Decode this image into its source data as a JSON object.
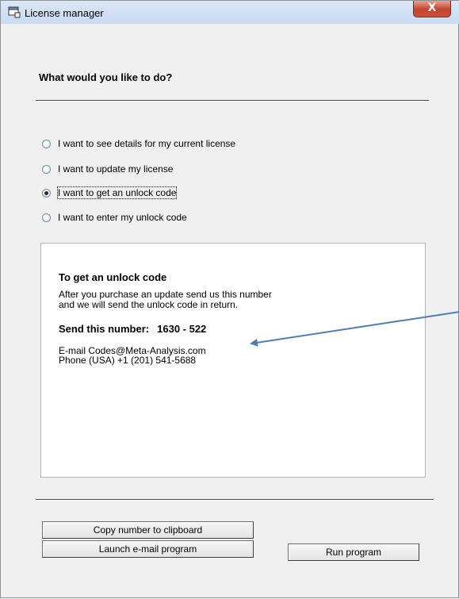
{
  "window": {
    "title": "License manager",
    "close_glyph": "X",
    "icon": "app-window-icon"
  },
  "prompt": "What would you like to do?",
  "options": [
    {
      "label": "I want to see details for my current license",
      "checked": false
    },
    {
      "label": "I want to update my license",
      "checked": false
    },
    {
      "label": "I want to get an unlock code",
      "checked": true
    },
    {
      "label": "I want to enter my unlock code",
      "checked": false
    }
  ],
  "info": {
    "heading": "To get an unlock code",
    "body_line1": "After you purchase an update send us this number",
    "body_line2": "and we will send the unlock code in return.",
    "send_label": "Send this number:",
    "send_number": "1630 - 522",
    "email": "E-mail Codes@Meta-Analysis.com",
    "phone": "Phone (USA) +1 (201) 541-5688"
  },
  "buttons": {
    "copy": "Copy number to clipboard",
    "launch": "Launch e-mail program",
    "run": "Run program"
  },
  "colors": {
    "arrow": "#4f7bb8",
    "close_button": "#c2442f"
  }
}
